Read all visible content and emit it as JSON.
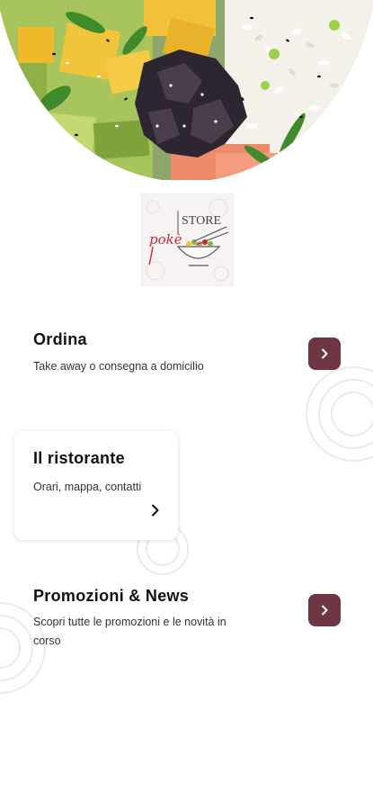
{
  "hero": {
    "icon": "poke-bowl-photo"
  },
  "logo": {
    "icon": "poke-store-logo",
    "text_store": "STORE",
    "text_poke": "pokè"
  },
  "menu": {
    "ordina": {
      "title": "Ordina",
      "subtitle": "Take away o consegna a domicilio",
      "icon": "chevron-right-icon"
    },
    "ristorante": {
      "title": "Il ristorante",
      "subtitle": "Orari, mappa, contatti",
      "icon": "chevron-right-icon"
    },
    "promozioni": {
      "title": "Promozioni & News",
      "subtitle_line1": "Scopri tutte le promozioni e le novità in",
      "subtitle_line2": "corso",
      "icon": "chevron-right-icon"
    }
  },
  "colors": {
    "accent": "#6e3543",
    "background": "#ffffff",
    "logo_red": "#c8283a"
  }
}
